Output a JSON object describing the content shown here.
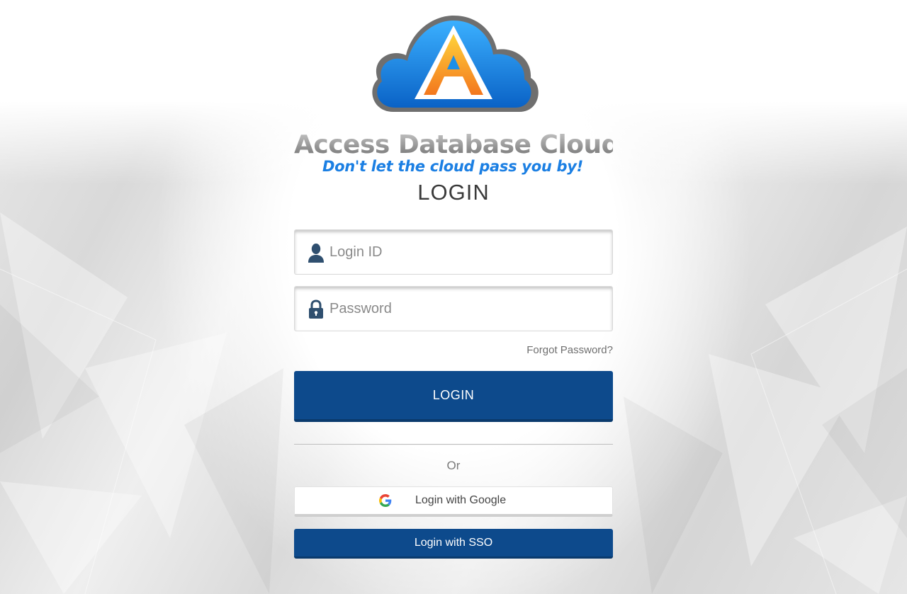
{
  "brand": {
    "name": "Access Database Cloud",
    "tagline": "Don't let the cloud pass you by!",
    "logo_letter": "A",
    "colors": {
      "cloud_blue": "#1b8fe8",
      "letter_orange": "#f7931e",
      "tagline_blue": "#1b7fe3",
      "wordmark_gray": "#8a8a8a"
    }
  },
  "login": {
    "heading": "LOGIN",
    "login_id": {
      "placeholder": "Login ID",
      "value": "",
      "icon": "user-icon"
    },
    "password": {
      "placeholder": "Password",
      "value": "",
      "icon": "lock-icon"
    },
    "forgot_password_label": "Forgot Password?",
    "submit_label": "LOGIN"
  },
  "alternatives": {
    "or_label": "Or",
    "google_label": "Login with Google",
    "google_icon": "google-icon",
    "sso_label": "Login with SSO"
  },
  "theme": {
    "primary": "#0d4a8c",
    "primary_dark": "#0a3a6d",
    "background": "#e6e6e6"
  }
}
